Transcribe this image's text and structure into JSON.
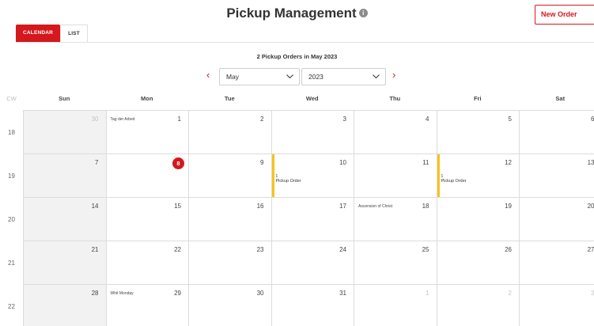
{
  "header": {
    "title": "Pickup Management",
    "info_icon": "i",
    "new_order_label": "New Order"
  },
  "tabs": [
    {
      "label": "CALENDAR",
      "active": true
    },
    {
      "label": "LIST",
      "active": false
    }
  ],
  "subtitle": "2 Pickup Orders in May 2023",
  "nav": {
    "prev_icon": "‹",
    "next_icon": "›",
    "month": "May",
    "year": "2023"
  },
  "weekday_headers": {
    "cw": "CW",
    "days": [
      "Sun",
      "Mon",
      "Tue",
      "Wed",
      "Thu",
      "Fri",
      "Sat"
    ]
  },
  "weeks": [
    {
      "cw": "18",
      "days": [
        {
          "n": "30",
          "muted": true,
          "grey": true
        },
        {
          "n": "1",
          "holiday": "Tag der Arbeit"
        },
        {
          "n": "2"
        },
        {
          "n": "3"
        },
        {
          "n": "4"
        },
        {
          "n": "5"
        },
        {
          "n": "6"
        }
      ]
    },
    {
      "cw": "19",
      "days": [
        {
          "n": "7",
          "grey": true
        },
        {
          "n": "8",
          "today": true
        },
        {
          "n": "9"
        },
        {
          "n": "10",
          "event": true,
          "ev_count": "1",
          "ev_label": "Pickup Order"
        },
        {
          "n": "11"
        },
        {
          "n": "12",
          "event": true,
          "ev_count": "1",
          "ev_label": "Pickup Order"
        },
        {
          "n": "13"
        }
      ]
    },
    {
      "cw": "20",
      "days": [
        {
          "n": "14",
          "grey": true
        },
        {
          "n": "15"
        },
        {
          "n": "16"
        },
        {
          "n": "17"
        },
        {
          "n": "18",
          "holiday": "Ascension of Christ"
        },
        {
          "n": "19"
        },
        {
          "n": "20"
        }
      ]
    },
    {
      "cw": "21",
      "days": [
        {
          "n": "21",
          "grey": true
        },
        {
          "n": "22"
        },
        {
          "n": "23"
        },
        {
          "n": "24"
        },
        {
          "n": "25"
        },
        {
          "n": "26"
        },
        {
          "n": "27"
        }
      ]
    },
    {
      "cw": "22",
      "days": [
        {
          "n": "28",
          "grey": true
        },
        {
          "n": "29",
          "holiday": "Whit Monday"
        },
        {
          "n": "30"
        },
        {
          "n": "31"
        },
        {
          "n": "1",
          "muted": true
        },
        {
          "n": "2",
          "muted": true
        },
        {
          "n": "3",
          "muted": true
        }
      ]
    }
  ],
  "colors": {
    "accent": "#d4181e",
    "event_bar": "#f5c518",
    "weekend_grey": "#f2f2f2"
  }
}
